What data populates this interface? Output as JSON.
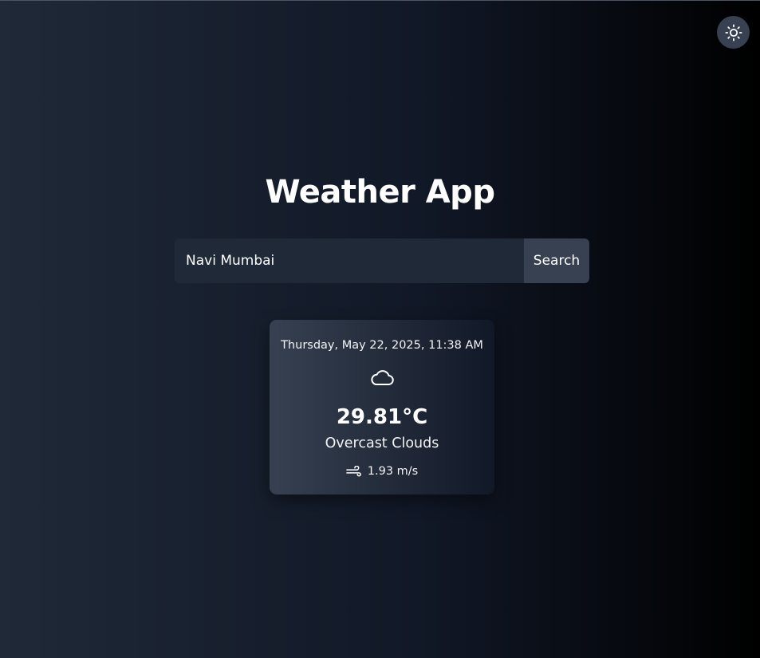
{
  "header": {
    "title": "Weather App",
    "theme_toggle_icon": "sun-icon"
  },
  "search": {
    "value": "Navi Mumbai",
    "placeholder": "",
    "button_label": "Search"
  },
  "weather": {
    "datetime": "Thursday, May 22, 2025, 11:38 AM",
    "condition_icon": "cloud-icon",
    "temperature": "29.81°C",
    "description": "Overcast Clouds",
    "wind_icon": "wind-icon",
    "wind_speed": "1.93 m/s"
  },
  "colors": {
    "background_start": "#1f2937",
    "background_end": "#000000",
    "input_background": "#1f2937",
    "button_background": "#374151",
    "toggle_background": "#374151",
    "text": "#ffffff"
  }
}
